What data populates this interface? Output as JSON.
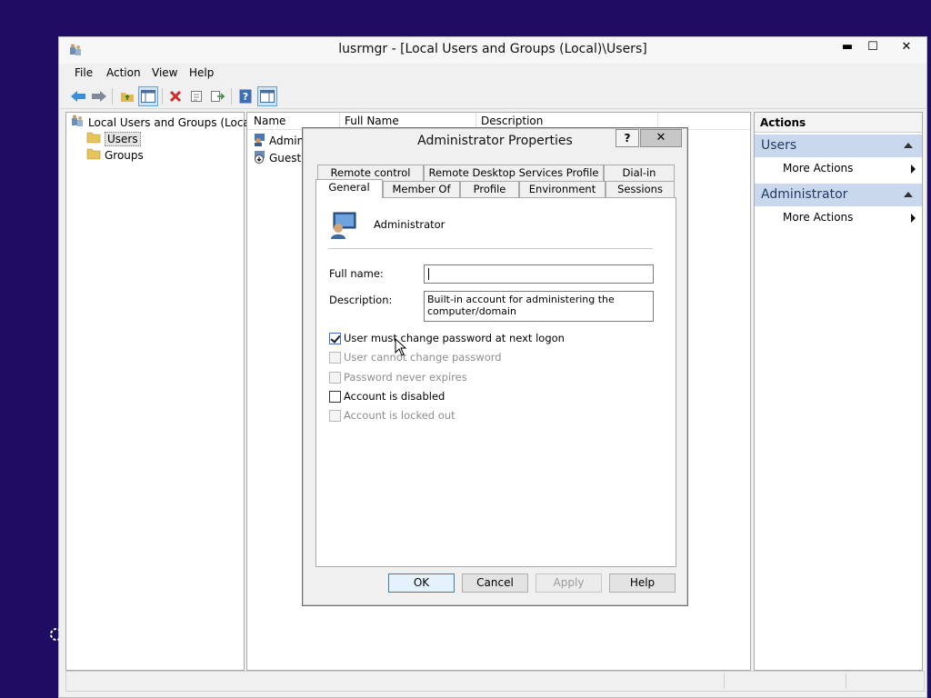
{
  "window": {
    "title": "lusrmgr - [Local Users and Groups (Local)\\Users]",
    "minimize": "▬",
    "maximize": "☐",
    "close": "✕"
  },
  "menu": [
    "File",
    "Action",
    "View",
    "Help"
  ],
  "tree": {
    "root": "Local Users and Groups (Local)",
    "items": [
      "Users",
      "Groups"
    ]
  },
  "list": {
    "columns": [
      "Name",
      "Full Name",
      "Description"
    ],
    "rows": [
      "Admin",
      "Guest"
    ]
  },
  "actions": {
    "title": "Actions",
    "sections": [
      {
        "heading": "Users",
        "item": "More Actions"
      },
      {
        "heading": "Administrator",
        "item": "More Actions"
      }
    ]
  },
  "dialog": {
    "title": "Administrator Properties",
    "help": "?",
    "close": "✕",
    "tabs_back": [
      "Remote control",
      "Remote Desktop Services Profile",
      "Dial-in"
    ],
    "tabs_front": [
      "General",
      "Member Of",
      "Profile",
      "Environment",
      "Sessions"
    ],
    "active_tab": "General",
    "username": "Administrator",
    "fullname_label": "Full name:",
    "fullname_value": "",
    "description_label": "Description:",
    "description_value": "Built-in account for administering the computer/domain",
    "checkboxes": [
      {
        "label": "User must change password at next logon",
        "checked": true,
        "enabled": true
      },
      {
        "label": "User cannot change password",
        "checked": false,
        "enabled": false
      },
      {
        "label": "Password never expires",
        "checked": false,
        "enabled": false
      },
      {
        "label": "Account is disabled",
        "checked": false,
        "enabled": true
      },
      {
        "label": "Account is locked out",
        "checked": false,
        "enabled": false
      }
    ],
    "buttons": [
      "OK",
      "Cancel",
      "Apply",
      "Help"
    ]
  },
  "colors": {
    "desktop": "#1e0d63",
    "accent": "#3c7fb1",
    "actions_header": "#c9d8ec"
  }
}
